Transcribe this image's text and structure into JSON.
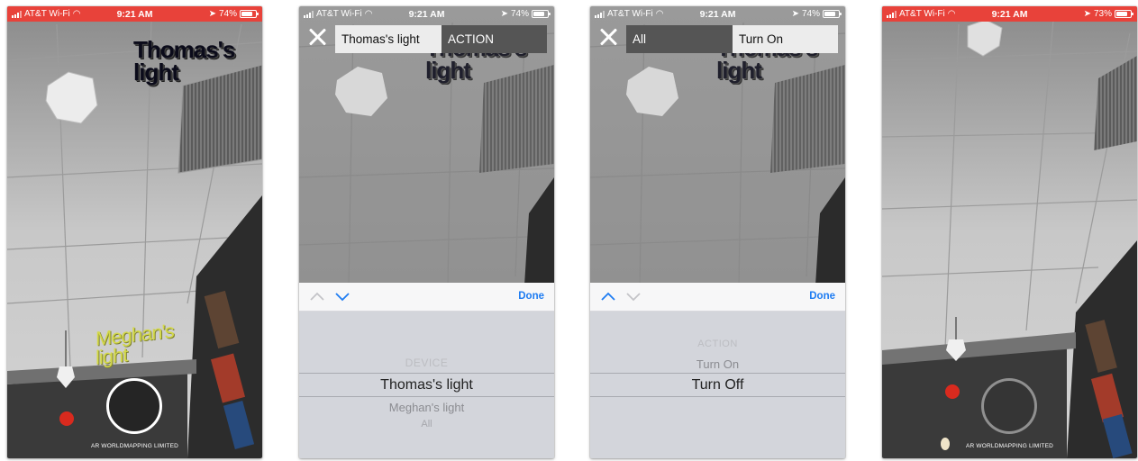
{
  "status": {
    "carrier": "AT&T Wi-Fi",
    "time": "9:21 AM",
    "battery_a": "74%",
    "battery_b": "73%"
  },
  "screen1": {
    "label_top": "Thomas's light",
    "label_bottom": "Meghan's light",
    "mapping_status": "AR WORLDMAPPING LIMITED"
  },
  "screen2": {
    "device_field": "Thomas's light",
    "action_field": "ACTION",
    "label_top": "Thomas's light",
    "done": "Done",
    "picker": {
      "heading": "DEVICE",
      "selected": "Thomas's light",
      "options": [
        "Meghan's light",
        "All"
      ]
    }
  },
  "screen3": {
    "device_field": "All",
    "action_field": "Turn On",
    "label_top": "Thomas's light",
    "done": "Done",
    "picker": {
      "heading": "ACTION",
      "option_above": "Turn On",
      "selected": "Turn Off"
    }
  },
  "screen4": {
    "mapping_status": "AR WORLDMAPPING LIMITED"
  },
  "colors": {
    "statusbar_red": "#e8423a",
    "done_blue": "#1e7cf2",
    "meghan_label": "#d4d94a"
  }
}
